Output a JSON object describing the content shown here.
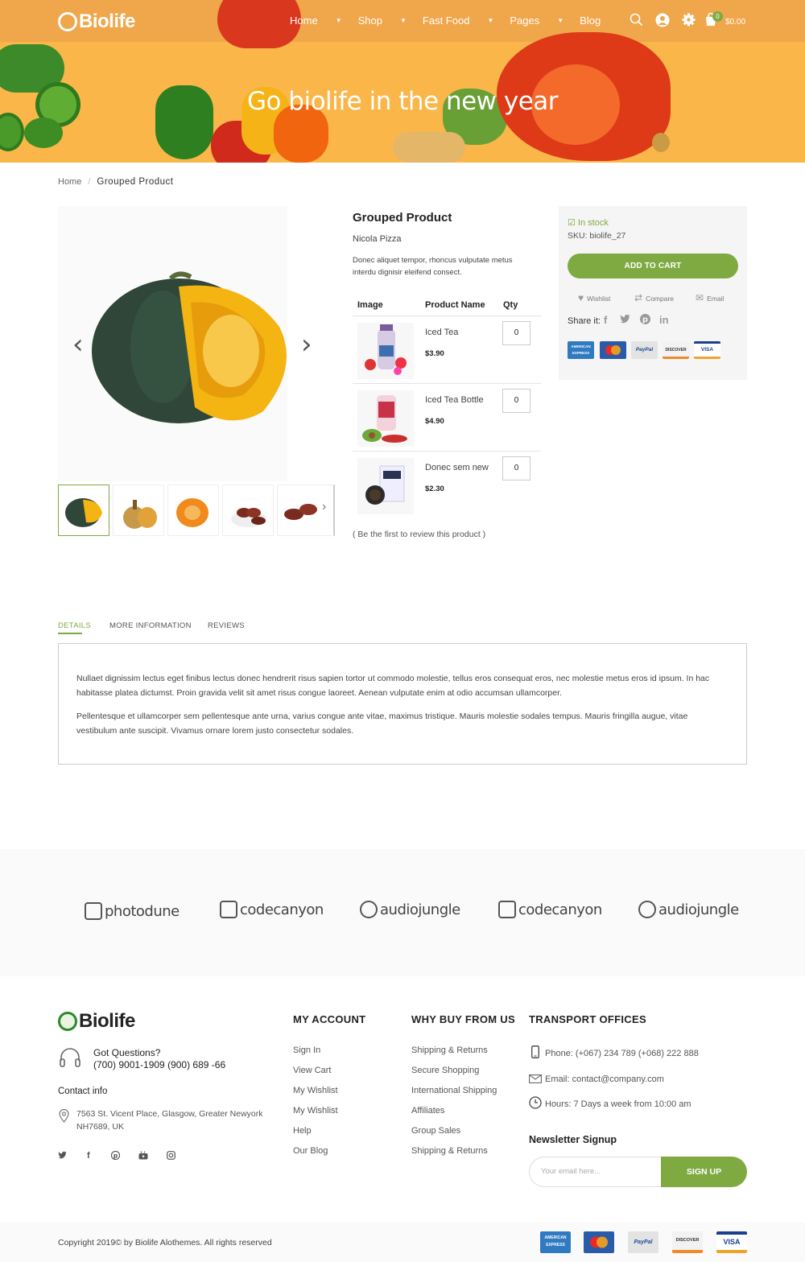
{
  "header": {
    "logo": "Biolife",
    "nav": [
      "Home",
      "Shop",
      "Fast Food",
      "Pages",
      "Blog"
    ],
    "nav_dropdown": [
      true,
      true,
      true,
      true,
      false
    ],
    "cart_count": "0",
    "cart_total": "$0.00",
    "icons": [
      "search-icon",
      "user-icon",
      "gear-icon",
      "cart-icon"
    ],
    "banner_title": "Go biolife in the new year"
  },
  "breadcrumb": {
    "home": "Home",
    "separator": "/",
    "current": "Grouped Product"
  },
  "product": {
    "name": "Grouped Product",
    "brand": "Nicola Pizza",
    "description": "Donec aliquet tempor, rhoncus vulputate metus interdu dignisir eleifend consect.",
    "table_headers": {
      "image": "Image",
      "name": "Product Name",
      "qty": "Qty"
    },
    "items": [
      {
        "name": "Iced Tea",
        "price": "$3.90",
        "qty": "0"
      },
      {
        "name": "Iced Tea Bottle",
        "price": "$4.90",
        "qty": "0"
      },
      {
        "name": "Donec sem new",
        "price": "$2.30",
        "qty": "0"
      }
    ],
    "review_link": "( Be the first to review this product )"
  },
  "sidebar": {
    "stock": "In stock",
    "sku": "SKU: biolife_27",
    "add_to_cart": "ADD TO CART",
    "wishlist": "Wishlist",
    "compare": "Compare",
    "email": "Email",
    "share_label": "Share it:",
    "cards": [
      "AMERICAN EXPRESS",
      "",
      "PayPal",
      "DISCOVER",
      "VISA"
    ]
  },
  "tabs": [
    "DETAILS",
    "MORE INFORMATION",
    "REVIEWS"
  ],
  "details": [
    "Nullaet dignissim lectus eget finibus lectus donec hendrerit risus sapien tortor ut commodo molestie, tellus eros consequat eros, nec molestie metus eros id ipsum. In hac habitasse platea dictumst. Proin gravida velit sit amet risus congue laoreet. Aenean vulputate enim at odio accumsan ullamcorper.",
    "Pellentesque et ullamcorper sem pellentesque ante urna, varius congue ante vitae, maximus tristique. Mauris molestie sodales tempus. Mauris fringilla augue, vitae vestibulum ante suscipit. Vivamus ornare lorem justo consectetur sodales."
  ],
  "brands": [
    "photodune",
    "codecanyon",
    "audiojungle",
    "codecanyon",
    "audiojungle"
  ],
  "footer": {
    "logo": "Biolife",
    "questions_title": "Got Questions?",
    "questions_phone": "(700)  9001-1909 (900) 689 -66",
    "contact_title": "Contact info",
    "address": "7563 St. Vicent Place, Glasgow, Greater Newyork NH7689, UK",
    "my_account_title": "MY ACCOUNT",
    "my_account": [
      "Sign In",
      "View Cart",
      "My Wishlist",
      "My Wishlist",
      "Help",
      "Our Blog"
    ],
    "why_title": "WHY BUY FROM US",
    "why": [
      "Shipping & Returns",
      "Secure Shopping",
      "International Shipping",
      "Affiliates",
      "Group Sales",
      "Shipping & Returns"
    ],
    "transport_title": "TRANSPORT OFFICES",
    "phone": "Phone: (+067) 234 789 (+068) 222 888",
    "email": "Email: contact@company.com",
    "hours": "Hours: 7 Days a week from 10:00 am",
    "newsletter_title": "Newsletter Signup",
    "newsletter_placeholder": "Your email here...",
    "newsletter_button": "SIGN UP",
    "copyright": "Copyright 2019© by Biolife Alothemes. All rights reserved"
  },
  "colors": {
    "accent": "#7faa41",
    "banner": "#fbb64a",
    "topbar": "#f0a64a"
  }
}
